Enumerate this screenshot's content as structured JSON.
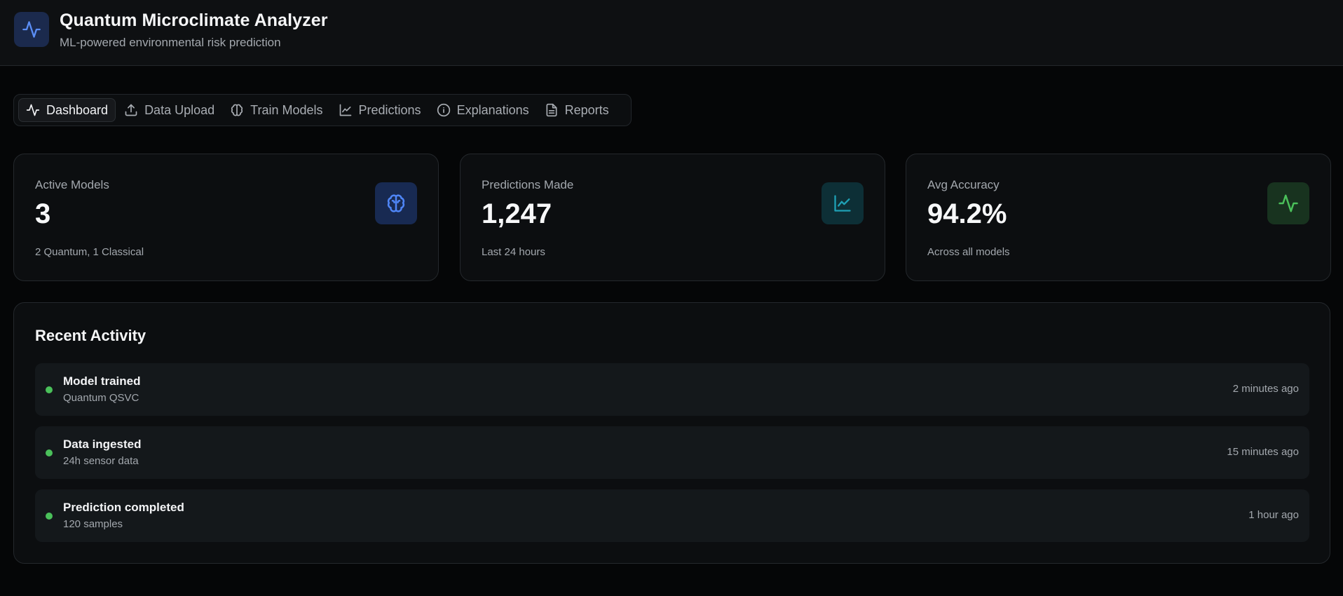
{
  "header": {
    "title": "Quantum Microclimate Analyzer",
    "subtitle": "ML-powered environmental risk prediction",
    "logo_icon": "activity-icon",
    "logo_color": "#5b8ef5"
  },
  "tabs": [
    {
      "label": "Dashboard",
      "icon": "activity-icon",
      "active": true
    },
    {
      "label": "Data Upload",
      "icon": "upload-icon",
      "active": false
    },
    {
      "label": "Train Models",
      "icon": "brain-icon",
      "active": false
    },
    {
      "label": "Predictions",
      "icon": "line-chart-icon",
      "active": false
    },
    {
      "label": "Explanations",
      "icon": "info-icon",
      "active": false
    },
    {
      "label": "Reports",
      "icon": "file-text-icon",
      "active": false
    }
  ],
  "stats": [
    {
      "label": "Active Models",
      "value": "3",
      "sub": "2 Quantum, 1 Classical",
      "icon": "brain-icon",
      "icon_color": "#4f86f7",
      "icon_bg": "#182a52"
    },
    {
      "label": "Predictions Made",
      "value": "1,247",
      "sub": "Last 24 hours",
      "icon": "line-chart-icon",
      "icon_color": "#1fa0b5",
      "icon_bg": "#0d2f36"
    },
    {
      "label": "Avg Accuracy",
      "value": "94.2%",
      "sub": "Across all models",
      "icon": "activity-icon",
      "icon_color": "#4ac05a",
      "icon_bg": "#18331f"
    }
  ],
  "activity": {
    "title": "Recent Activity",
    "items": [
      {
        "title": "Model trained",
        "sub": "Quantum QSVC",
        "time": "2 minutes ago",
        "status_color": "#4ac05a"
      },
      {
        "title": "Data ingested",
        "sub": "24h sensor data",
        "time": "15 minutes ago",
        "status_color": "#4ac05a"
      },
      {
        "title": "Prediction completed",
        "sub": "120 samples",
        "time": "1 hour ago",
        "status_color": "#4ac05a"
      }
    ]
  }
}
